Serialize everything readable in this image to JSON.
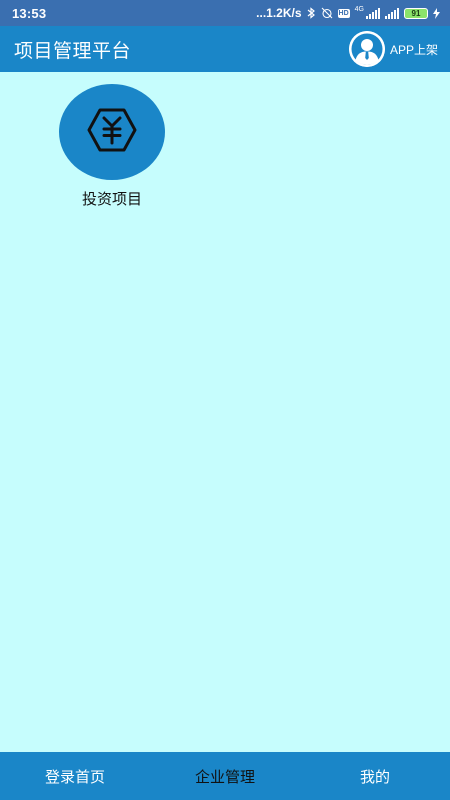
{
  "status_bar": {
    "time": "13:53",
    "network_speed": "...1.2K/s",
    "net_label": "4G",
    "hd_label": "HD",
    "battery_level": "91"
  },
  "app_bar": {
    "title": "项目管理平台",
    "action_label": "APP上架",
    "avatar_icon": "user-avatar-icon"
  },
  "grid": {
    "items": [
      {
        "label": "投资项目",
        "icon": "yuan-hexagon-icon"
      }
    ]
  },
  "bottom_nav": {
    "items": [
      {
        "label": "登录首页"
      },
      {
        "label": "企业管理"
      },
      {
        "label": "我的"
      }
    ],
    "active_index": 1
  },
  "colors": {
    "status_bar": "#3a6fb0",
    "primary": "#1a86c8",
    "background": "#c6fdfd",
    "text_dark": "#111111",
    "text_light": "#ffffff"
  }
}
